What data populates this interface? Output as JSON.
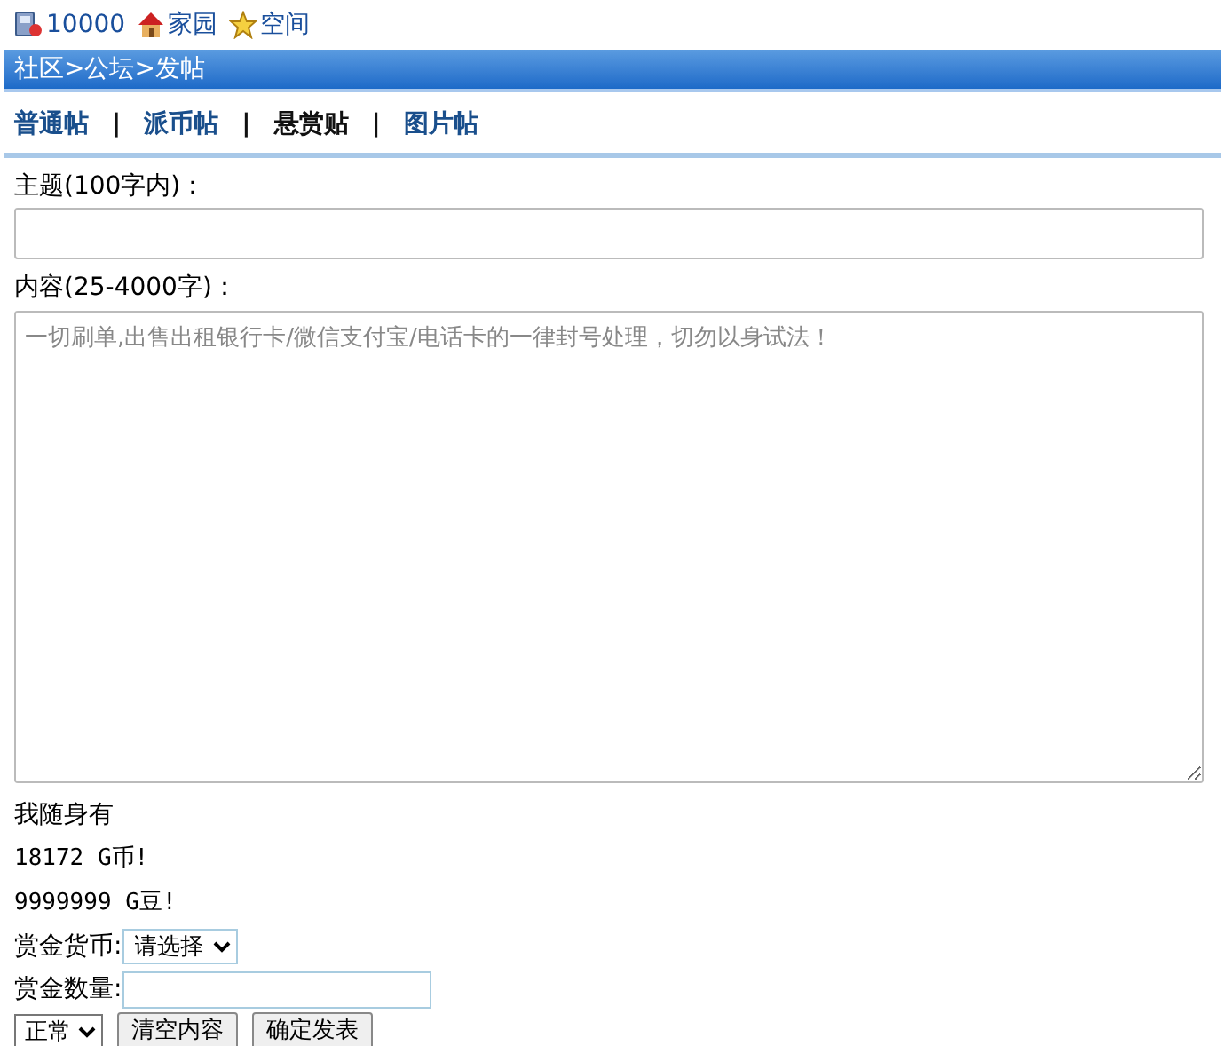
{
  "top_links": [
    {
      "kind": "user",
      "label": "10000"
    },
    {
      "kind": "home",
      "label": "家园"
    },
    {
      "kind": "space",
      "label": "空间"
    }
  ],
  "breadcrumb": "社区>公坛>发帖",
  "tabs": [
    {
      "label": "普通帖",
      "selected": false
    },
    {
      "label": "派币帖",
      "selected": false
    },
    {
      "label": "悬赏贴",
      "selected": true
    },
    {
      "label": "图片帖",
      "selected": false
    }
  ],
  "tab_separator": "|",
  "subject": {
    "label": "主题(100字内)："
  },
  "content": {
    "label": "内容(25-4000字)：",
    "placeholder": "一切刷单,出售出租银行卡/微信支付宝/电话卡的一律封号处理，切勿以身试法！"
  },
  "wallet": {
    "title": "我随身有",
    "lines": [
      "18172 G币!",
      "9999999 G豆!"
    ]
  },
  "currency": {
    "label": "赏金货币:",
    "value": "请选择"
  },
  "amount": {
    "label": "赏金数量:"
  },
  "mode": {
    "value": "正常"
  },
  "buttons": [
    "清空内容",
    "确定发表"
  ]
}
